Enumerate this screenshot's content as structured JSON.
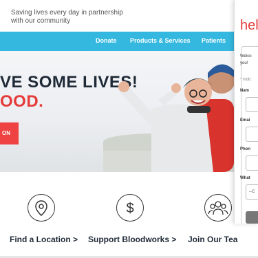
{
  "header": {
    "tagline": "Saving lives every day in partnership with our community"
  },
  "nav": {
    "items": [
      "Donate",
      "Products & Services",
      "Patients"
    ]
  },
  "hero": {
    "headline_line1": "VE SOME LIVES!",
    "headline_line2": "OOD.",
    "cta_label": "ON"
  },
  "features": [
    {
      "label": "Find a Location >",
      "icon": "location-pin-icon"
    },
    {
      "label": "Support Bloodworks >",
      "icon": "dollar-icon"
    },
    {
      "label": "Join Our Tea",
      "icon": "group-icon"
    }
  ],
  "signup_panel": {
    "logo": "hel",
    "welcome_line1": "Welco",
    "welcome_line2": "you!",
    "required_note": "* indic",
    "fields": [
      {
        "label": "Nam"
      },
      {
        "label": "Emai"
      },
      {
        "label": "Phon"
      }
    ],
    "select_label": "What",
    "select_value": "--C"
  },
  "colors": {
    "nav_bg": "#34b8df",
    "accent_red": "#e53a3a",
    "cta_red": "#ee4342",
    "heading_dark": "#1f2a37"
  }
}
